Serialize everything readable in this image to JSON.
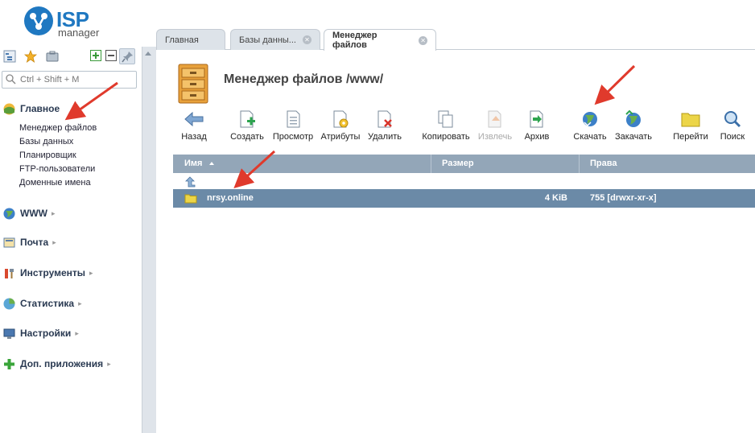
{
  "app": {
    "logo_big": "ISP",
    "logo_small": "manager"
  },
  "sidebar": {
    "search_placeholder": "Ctrl + Shift + M",
    "groups": [
      {
        "label": "Главное",
        "icon": "home-globe-icon",
        "expanded": true,
        "items": [
          "Менеджер файлов",
          "Базы данных",
          "Планировщик",
          "FTP-пользователи",
          "Доменные имена"
        ]
      },
      {
        "label": "WWW",
        "icon": "www-globe-icon"
      },
      {
        "label": "Почта",
        "icon": "mail-icon"
      },
      {
        "label": "Инструменты",
        "icon": "tools-icon"
      },
      {
        "label": "Статистика",
        "icon": "statistics-icon"
      },
      {
        "label": "Настройки",
        "icon": "settings-icon"
      },
      {
        "label": "Доп. приложения",
        "icon": "plus-icon"
      }
    ]
  },
  "tabs": [
    {
      "label": "Главная"
    },
    {
      "label": "Базы данны..."
    },
    {
      "label": "Менеджер файлов",
      "active": true
    }
  ],
  "page": {
    "title": "Менеджер файлов /www/"
  },
  "toolbar": [
    {
      "label": "Назад",
      "icon": "back-arrow-icon"
    },
    {
      "label": "Создать",
      "icon": "create-icon"
    },
    {
      "label": "Просмотр",
      "icon": "view-icon"
    },
    {
      "label": "Атрибуты",
      "icon": "attributes-icon"
    },
    {
      "label": "Удалить",
      "icon": "delete-icon"
    },
    {
      "label": "Копировать",
      "icon": "copy-icon"
    },
    {
      "label": "Извлечь",
      "icon": "extract-icon",
      "disabled": true
    },
    {
      "label": "Архив",
      "icon": "archive-icon"
    },
    {
      "label": "Скачать",
      "icon": "download-icon"
    },
    {
      "label": "Закачать",
      "icon": "upload-icon"
    },
    {
      "label": "Перейти",
      "icon": "folder-go-icon"
    },
    {
      "label": "Поиск",
      "icon": "search-icon"
    }
  ],
  "table": {
    "columns": [
      "Имя",
      "Размер",
      "Права"
    ],
    "rows": [
      {
        "name": "nrsy.online",
        "size": "4 KiB",
        "perms": "755 [drwxr-xr-x]"
      }
    ]
  },
  "colors": {
    "accent": "#1f78c1",
    "header": "#93a6b8",
    "selected_row": "#6b8aa7",
    "annotation_arrow": "#e03a2c"
  }
}
